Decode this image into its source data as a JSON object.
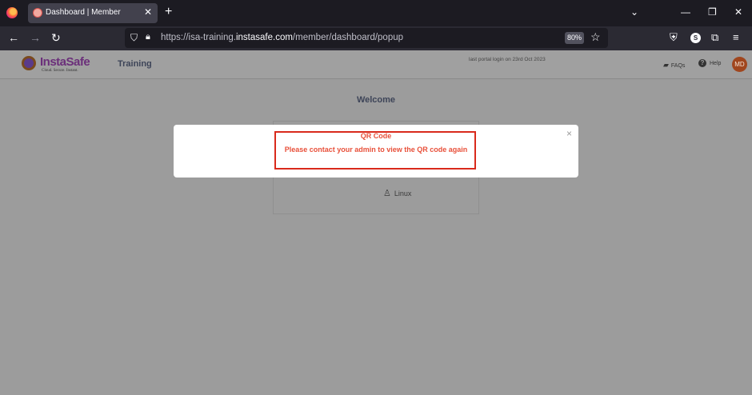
{
  "browser": {
    "tab_title": "Dashboard | Member",
    "tab_close": "✕",
    "new_tab": "+",
    "url_prefix": "https://isa-training.",
    "url_domain": "instasafe.com",
    "url_path": "/member/dashboard/popup",
    "zoom": "80%",
    "extension_badge": "S"
  },
  "header": {
    "logo_text": "InstaSafe",
    "logo_tagline": "Cloud. Secure. Instant.",
    "section_title": "Training",
    "last_login": "last portal login on 23rd Oct 2023",
    "faqs_label": "FAQs",
    "help_label": "Help",
    "avatar_initials": "MD"
  },
  "main": {
    "welcome": "Welcome",
    "os_option": "Linux"
  },
  "modal": {
    "close": "×",
    "title": "QR Code",
    "message": "Please contact your admin to view the QR code again"
  },
  "colors": {
    "modal_text": "#e8503a",
    "highlight_border": "#d92a1c",
    "overlay": "#9c9c9c"
  }
}
